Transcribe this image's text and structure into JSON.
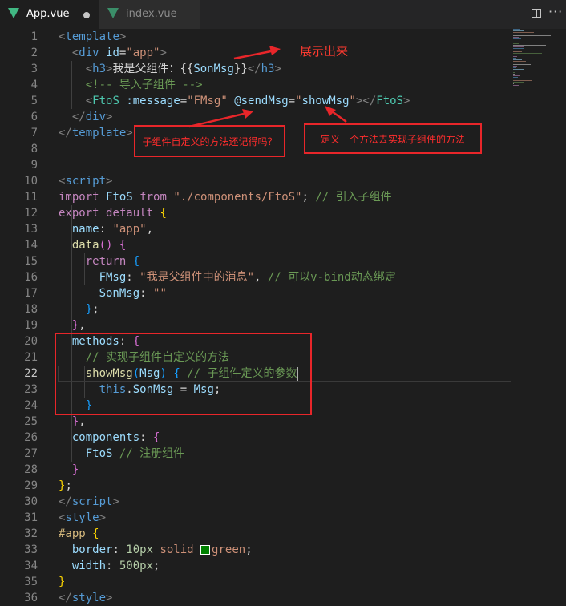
{
  "tabs": [
    {
      "label": "App.vue",
      "active": true,
      "dirty": true
    },
    {
      "label": "index.vue",
      "active": false,
      "dirty": false
    }
  ],
  "editor": {
    "current_line": 22,
    "lines": [
      {
        "n": 1,
        "t": [
          [
            "t-br",
            "<"
          ],
          [
            "t-tag",
            "template"
          ],
          [
            "t-br",
            ">"
          ]
        ]
      },
      {
        "n": 2,
        "t": [
          [
            "",
            "  "
          ],
          [
            "t-br",
            "<"
          ],
          [
            "t-tag",
            "div"
          ],
          [
            "",
            " "
          ],
          [
            "t-attr",
            "id"
          ],
          [
            "",
            "="
          ],
          [
            "t-str",
            "\"app\""
          ],
          [
            "t-br",
            ">"
          ]
        ]
      },
      {
        "n": 3,
        "t": [
          [
            "",
            "    "
          ],
          [
            "t-br",
            "<"
          ],
          [
            "t-tag",
            "h3"
          ],
          [
            "t-br",
            ">"
          ],
          [
            "",
            "我是父组件：{{"
          ],
          [
            "t-var",
            "SonMsg"
          ],
          [
            "",
            "}}"
          ],
          [
            "t-br",
            "</"
          ],
          [
            "t-tag",
            "h3"
          ],
          [
            "t-br",
            ">"
          ]
        ]
      },
      {
        "n": 4,
        "t": [
          [
            "",
            "    "
          ],
          [
            "t-com",
            "<!-- 导入子组件 -->"
          ]
        ]
      },
      {
        "n": 5,
        "t": [
          [
            "",
            "    "
          ],
          [
            "t-br",
            "<"
          ],
          [
            "t-cls",
            "FtoS"
          ],
          [
            "",
            " "
          ],
          [
            "t-attr",
            ":message"
          ],
          [
            "",
            "="
          ],
          [
            "t-str",
            "\"FMsg\""
          ],
          [
            "",
            " "
          ],
          [
            "t-attr",
            "@sendMsg"
          ],
          [
            "",
            "="
          ],
          [
            "t-str",
            "\""
          ],
          [
            "t-var",
            "showMsg"
          ],
          [
            "t-str",
            "\""
          ],
          [
            "t-br",
            "></"
          ],
          [
            "t-cls",
            "FtoS"
          ],
          [
            "t-br",
            ">"
          ]
        ]
      },
      {
        "n": 6,
        "t": [
          [
            "",
            "  "
          ],
          [
            "t-br",
            "</"
          ],
          [
            "t-tag",
            "div"
          ],
          [
            "t-br",
            ">"
          ]
        ]
      },
      {
        "n": 7,
        "t": [
          [
            "t-br",
            "</"
          ],
          [
            "t-tag",
            "template"
          ],
          [
            "t-br",
            ">"
          ]
        ]
      },
      {
        "n": 8,
        "t": []
      },
      {
        "n": 9,
        "t": []
      },
      {
        "n": 10,
        "t": [
          [
            "t-br",
            "<"
          ],
          [
            "t-tag",
            "script"
          ],
          [
            "t-br",
            ">"
          ]
        ]
      },
      {
        "n": 11,
        "t": [
          [
            "t-kw",
            "import"
          ],
          [
            "",
            " "
          ],
          [
            "t-var",
            "FtoS"
          ],
          [
            "",
            " "
          ],
          [
            "t-kw",
            "from"
          ],
          [
            "",
            " "
          ],
          [
            "t-str",
            "\"./components/FtoS\""
          ],
          [
            "",
            ";"
          ],
          [
            "",
            " "
          ],
          [
            "t-com",
            "// 引入子组件"
          ]
        ]
      },
      {
        "n": 12,
        "t": [
          [
            "t-kw",
            "export"
          ],
          [
            "",
            " "
          ],
          [
            "t-kw",
            "default"
          ],
          [
            "",
            " "
          ],
          [
            "t-b1",
            "{"
          ]
        ]
      },
      {
        "n": 13,
        "t": [
          [
            "",
            "  "
          ],
          [
            "t-var",
            "name"
          ],
          [
            "",
            ": "
          ],
          [
            "t-str",
            "\"app\""
          ],
          [
            "",
            ","
          ]
        ]
      },
      {
        "n": 14,
        "t": [
          [
            "",
            "  "
          ],
          [
            "t-fn",
            "data"
          ],
          [
            "t-b2",
            "()"
          ],
          [
            "",
            " "
          ],
          [
            "t-b2",
            "{"
          ]
        ]
      },
      {
        "n": 15,
        "t": [
          [
            "",
            "    "
          ],
          [
            "t-kw",
            "return"
          ],
          [
            "",
            " "
          ],
          [
            "t-b3",
            "{"
          ]
        ]
      },
      {
        "n": 16,
        "t": [
          [
            "",
            "      "
          ],
          [
            "t-var",
            "FMsg"
          ],
          [
            "",
            ": "
          ],
          [
            "t-str",
            "\"我是父组件中的消息\""
          ],
          [
            "",
            ", "
          ],
          [
            "t-com",
            "// 可以v-bind动态绑定"
          ]
        ]
      },
      {
        "n": 17,
        "t": [
          [
            "",
            "      "
          ],
          [
            "t-var",
            "SonMsg"
          ],
          [
            "",
            ": "
          ],
          [
            "t-str",
            "\"\""
          ]
        ]
      },
      {
        "n": 18,
        "t": [
          [
            "",
            "    "
          ],
          [
            "t-b3",
            "}"
          ],
          [
            "",
            ";"
          ]
        ]
      },
      {
        "n": 19,
        "t": [
          [
            "",
            "  "
          ],
          [
            "t-b2",
            "}"
          ],
          [
            "",
            ","
          ]
        ]
      },
      {
        "n": 20,
        "t": [
          [
            "",
            "  "
          ],
          [
            "t-var",
            "methods"
          ],
          [
            "",
            ": "
          ],
          [
            "t-b2",
            "{"
          ]
        ]
      },
      {
        "n": 21,
        "t": [
          [
            "",
            "    "
          ],
          [
            "t-com",
            "// 实现子组件自定义的方法"
          ]
        ]
      },
      {
        "n": 22,
        "t": [
          [
            "",
            "    "
          ],
          [
            "t-fn",
            "showMsg"
          ],
          [
            "t-b3",
            "("
          ],
          [
            "t-var",
            "Msg"
          ],
          [
            "t-b3",
            ")"
          ],
          [
            "",
            " "
          ],
          [
            "t-b3",
            "{"
          ],
          [
            "",
            " "
          ],
          [
            "t-com",
            "// 子组件定义的参数"
          ]
        ]
      },
      {
        "n": 23,
        "t": [
          [
            "",
            "      "
          ],
          [
            "t-kw2",
            "this"
          ],
          [
            "",
            "."
          ],
          [
            "t-var",
            "SonMsg"
          ],
          [
            "",
            " = "
          ],
          [
            "t-var",
            "Msg"
          ],
          [
            "",
            ";"
          ]
        ]
      },
      {
        "n": 24,
        "t": [
          [
            "",
            "    "
          ],
          [
            "t-b3",
            "}"
          ]
        ]
      },
      {
        "n": 25,
        "t": [
          [
            "",
            "  "
          ],
          [
            "t-b2",
            "}"
          ],
          [
            "",
            ","
          ]
        ]
      },
      {
        "n": 26,
        "t": [
          [
            "",
            "  "
          ],
          [
            "t-var",
            "components"
          ],
          [
            "",
            ": "
          ],
          [
            "t-b2",
            "{"
          ]
        ]
      },
      {
        "n": 27,
        "t": [
          [
            "",
            "    "
          ],
          [
            "t-var",
            "FtoS"
          ],
          [
            "",
            " "
          ],
          [
            "t-com",
            "// 注册组件"
          ]
        ]
      },
      {
        "n": 28,
        "t": [
          [
            "",
            "  "
          ],
          [
            "t-b2",
            "}"
          ]
        ]
      },
      {
        "n": 29,
        "t": [
          [
            "t-b1",
            "}"
          ],
          [
            "",
            ";"
          ]
        ]
      },
      {
        "n": 30,
        "t": [
          [
            "t-br",
            "</"
          ],
          [
            "t-tag",
            "script"
          ],
          [
            "t-br",
            ">"
          ]
        ]
      },
      {
        "n": 31,
        "t": [
          [
            "t-br",
            "<"
          ],
          [
            "t-tag",
            "style"
          ],
          [
            "t-br",
            ">"
          ]
        ]
      },
      {
        "n": 32,
        "t": [
          [
            "t-sel",
            "#app"
          ],
          [
            "",
            " "
          ],
          [
            "t-b1",
            "{"
          ]
        ]
      },
      {
        "n": 33,
        "t": [
          [
            "",
            "  "
          ],
          [
            "t-var",
            "border"
          ],
          [
            "",
            ": "
          ],
          [
            "t-num",
            "10px"
          ],
          [
            "",
            " "
          ],
          [
            "t-str",
            "solid"
          ],
          [
            "",
            " "
          ],
          [
            "swatch",
            ""
          ],
          [
            "t-str",
            "green"
          ],
          [
            "",
            ";"
          ]
        ]
      },
      {
        "n": 34,
        "t": [
          [
            "",
            "  "
          ],
          [
            "t-var",
            "width"
          ],
          [
            "",
            ": "
          ],
          [
            "t-num",
            "500px"
          ],
          [
            "",
            ";"
          ]
        ]
      },
      {
        "n": 35,
        "t": [
          [
            "t-b1",
            "}"
          ]
        ]
      },
      {
        "n": 36,
        "t": [
          [
            "t-br",
            "</"
          ],
          [
            "t-tag",
            "style"
          ],
          [
            "t-br",
            ">"
          ]
        ]
      }
    ]
  },
  "annotations": {
    "show_out": "展示出来",
    "remember": "子组件自定义的方法还记得吗？",
    "define": "定义一个方法去实现子组件的方法"
  },
  "colors": {
    "annotation": "#e8262a",
    "accent": "#41b883"
  }
}
